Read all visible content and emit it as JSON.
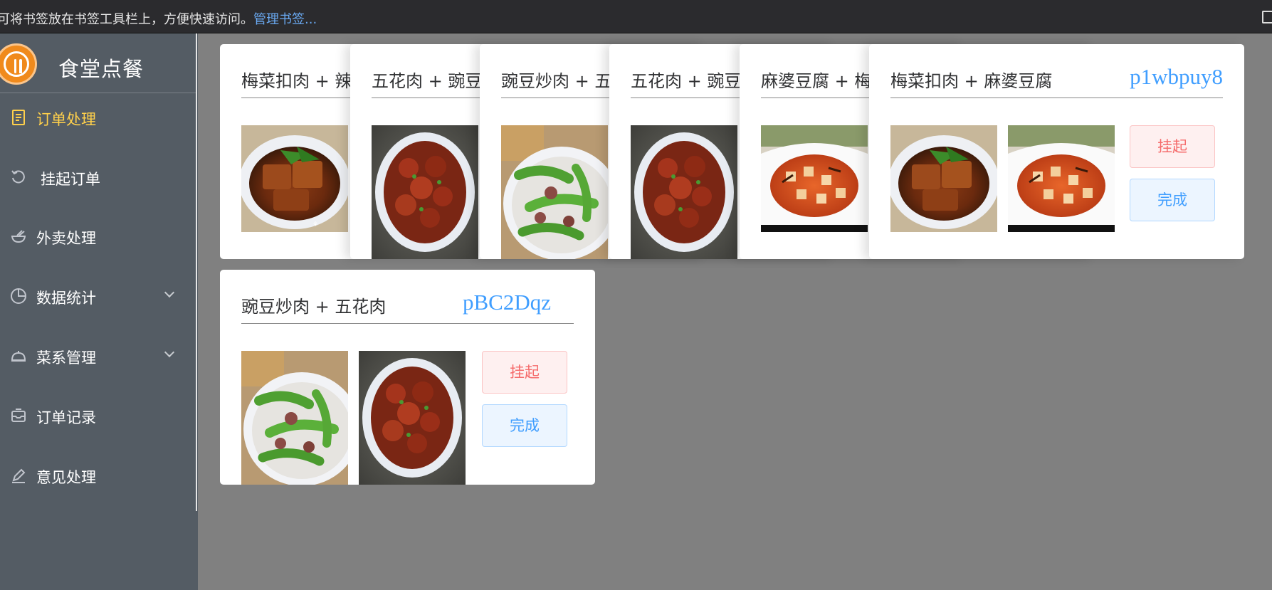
{
  "bookmark_bar": {
    "text": "可将书签放在书签工具栏上，方便快速访问。",
    "link": "管理书签..."
  },
  "sidebar": {
    "brand_title": "食堂点餐",
    "items": [
      {
        "label": "订单处理",
        "icon": "document-list-icon",
        "active": true
      },
      {
        "label": "挂起订单",
        "icon": "refresh-icon"
      },
      {
        "label": "外卖处理",
        "icon": "bowl-icon"
      },
      {
        "label": "数据统计",
        "icon": "pie-chart-icon",
        "expandable": true
      },
      {
        "label": "菜系管理",
        "icon": "cloche-icon",
        "expandable": true
      },
      {
        "label": "订单记录",
        "icon": "inbox-icon"
      },
      {
        "label": "意见处理",
        "icon": "pen-icon"
      }
    ]
  },
  "orders": {
    "stacked_titles": [
      "梅菜扣肉 + 辣子",
      "五花肉 + 豌豆炒",
      "豌豆炒肉 + 五花",
      "五花肉 + 豌豆炒",
      "麻婆豆腐 + 梅菜"
    ],
    "cards": [
      {
        "title": "梅菜扣肉 + 麻婆豆腐",
        "code": "p1wbpuy8",
        "hold_label": "挂起",
        "done_label": "完成"
      },
      {
        "title": "豌豆炒肉 + 五花肉",
        "code": "pBC2Dqz",
        "hold_label": "挂起",
        "done_label": "完成"
      }
    ]
  },
  "colors": {
    "sidebar_bg": "#545c64",
    "active_menu": "#ffd04b",
    "code_blue": "#409eff",
    "hold_red": "#f56c6c"
  }
}
